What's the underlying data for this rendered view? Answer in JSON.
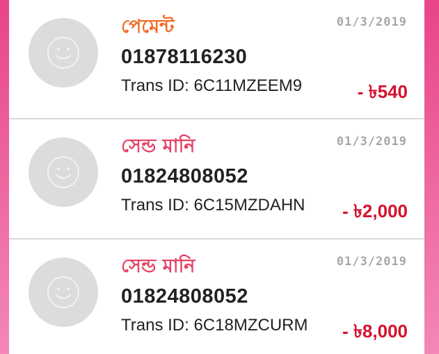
{
  "colors": {
    "payment_label": "#f06c28",
    "send_money_label": "#e54467",
    "amount": "#d6112e",
    "date": "#a7a7a7",
    "avatar_bg": "#dcdcdc",
    "avatar_icon": "#f2f2f2"
  },
  "transactions": [
    {
      "type": "পেমেন্ট",
      "type_kind": "payment",
      "date": "01/3/2019",
      "number": "01878116230",
      "trans_id": "Trans ID: 6C11MZEEM9",
      "amount": "- ৳540",
      "avatar_icon": "smiley-face-icon"
    },
    {
      "type": "সেন্ড মানি",
      "type_kind": "send_money",
      "date": "01/3/2019",
      "number": "01824808052",
      "trans_id": "Trans ID: 6C15MZDAHN",
      "amount": "- ৳2,000",
      "avatar_icon": "smiley-face-icon"
    },
    {
      "type": "সেন্ড মানি",
      "type_kind": "send_money",
      "date": "01/3/2019",
      "number": "01824808052",
      "trans_id": "Trans ID: 6C18MZCURM",
      "amount": "- ৳8,000",
      "avatar_icon": "smiley-face-icon"
    }
  ]
}
